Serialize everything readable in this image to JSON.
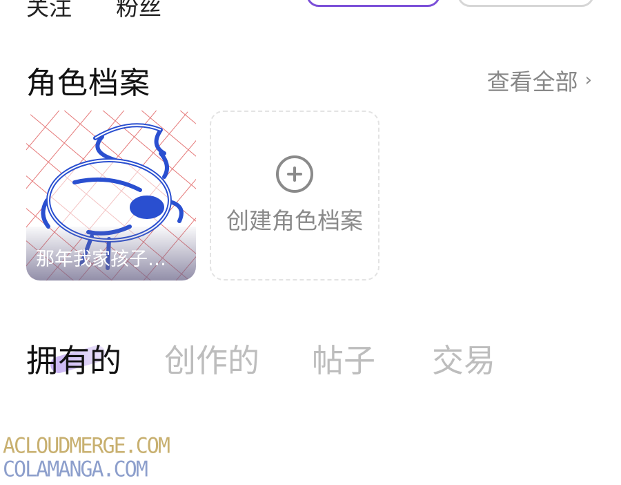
{
  "top_row": {
    "stat_1_label": "关注",
    "stat_2_label": "粉丝"
  },
  "characters_section": {
    "title": "角色档案",
    "view_all_label": "查看全部",
    "view_all_chevron": "›",
    "cards": [
      {
        "name": "那年我家孩子…"
      }
    ],
    "create_label": "创建角色档案"
  },
  "tabs": [
    {
      "label": "拥有的",
      "active": true
    },
    {
      "label": "创作的",
      "active": false
    },
    {
      "label": "帖子",
      "active": false
    },
    {
      "label": "交易",
      "active": false
    }
  ],
  "watermark": {
    "line_1": "ACLOUDMERGE.COM",
    "line_2": "COLAMANGA.COM"
  },
  "colors": {
    "accent": "#7b4fd8",
    "muted_text": "#888888",
    "inactive_tab": "#bdbdbd"
  }
}
